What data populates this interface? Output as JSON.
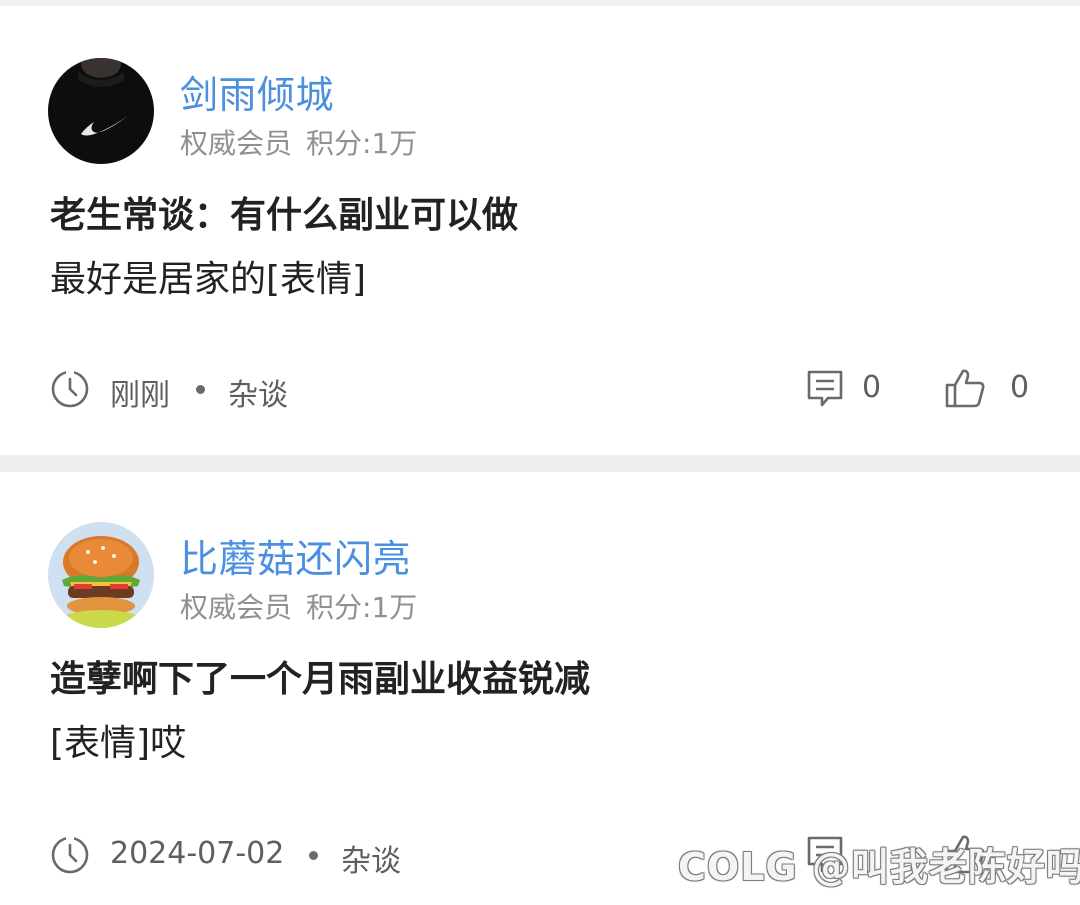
{
  "posts": [
    {
      "username": "剑雨倾城",
      "member_level": "权威会员",
      "score": "积分:1万",
      "content_line1": "老生常谈：有什么副业可以做",
      "content_line2": "最好是居家的[表情]",
      "time": "刚刚",
      "category": "杂谈",
      "comment_count": "0",
      "like_count": "0",
      "avatar": "black-shirt-swoosh-avatar"
    },
    {
      "username": "比蘑菇还闪亮",
      "member_level": "权威会员",
      "score": "积分:1万",
      "content_line1": "造孽啊下了一个月雨副业收益锐减",
      "content_line2": "[表情]哎",
      "time": "2024-07-02",
      "category": "杂谈",
      "avatar": "burger-avatar"
    }
  ],
  "watermark": "COLG @叫我老陈好吗",
  "colors": {
    "username": "#4a8fe0",
    "meta": "#8f8f94",
    "content": "#222222",
    "footer_text": "#5f5f63",
    "separator": "#efeff1"
  },
  "icons": {
    "time": "clock-icon",
    "comment": "comment-icon",
    "like": "thumbs-up-icon"
  }
}
